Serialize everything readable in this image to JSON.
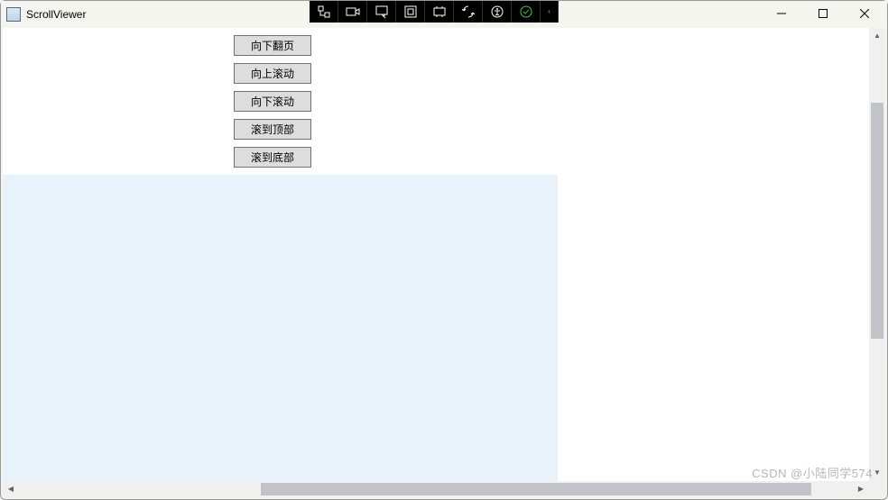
{
  "window": {
    "title": "ScrollViewer"
  },
  "buttons": {
    "page_down": "向下翻页",
    "scroll_up": "向上滚动",
    "scroll_down": "向下滚动",
    "scroll_top": "滚到顶部",
    "scroll_bottom": "滚到底部"
  },
  "scrollbars": {
    "v_thumb_top_pct": 14,
    "v_thumb_height_pct": 56,
    "h_thumb_left_pct": 29,
    "h_thumb_width_pct": 66
  },
  "watermark": "CSDN @小陆同学574"
}
